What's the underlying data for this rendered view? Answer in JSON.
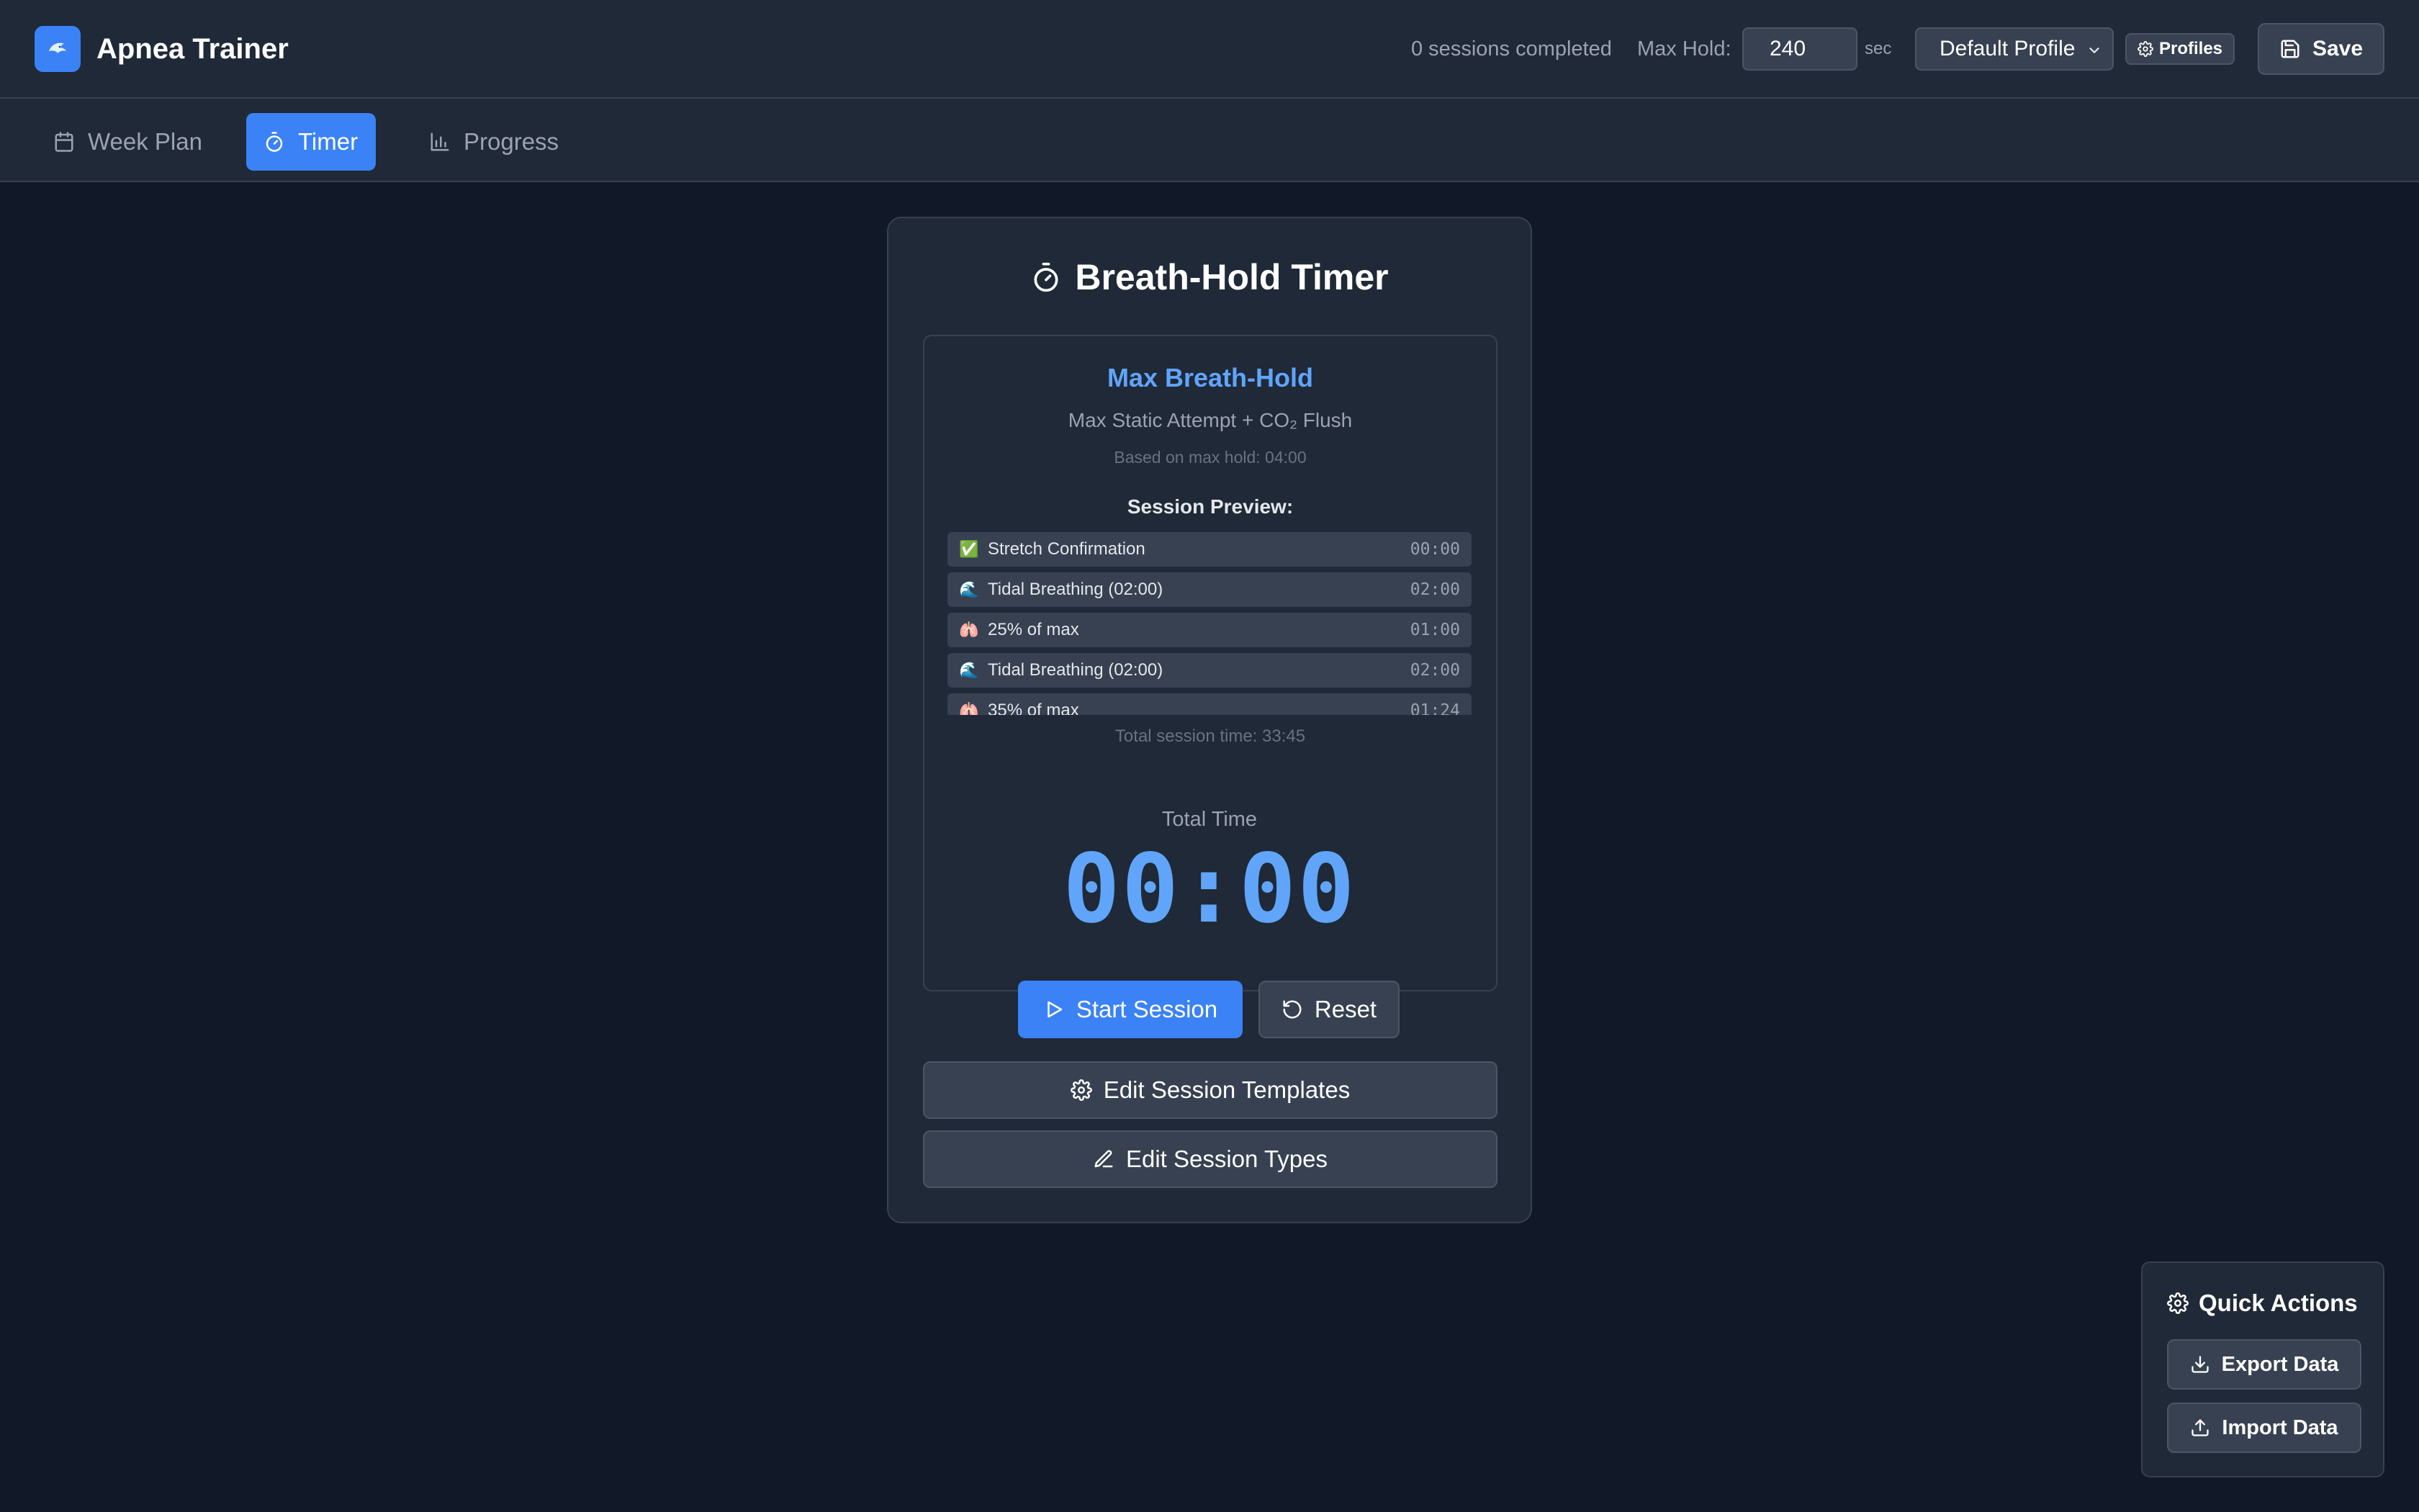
{
  "header": {
    "app_icon": "dolphin-logo",
    "app_title": "Apnea Trainer",
    "sessions_completed": "0 sessions completed",
    "max_hold_label": "Max Hold:",
    "max_hold_value": "240",
    "max_hold_unit": "sec",
    "profile_selected": "Default Profile",
    "profiles_button": "Profiles",
    "save_button": "Save"
  },
  "tabs": [
    {
      "label": "Week Plan",
      "icon": "calendar-icon",
      "active": false
    },
    {
      "label": "Timer",
      "icon": "stopwatch-icon",
      "active": true
    },
    {
      "label": "Progress",
      "icon": "bar-chart-icon",
      "active": false
    }
  ],
  "timer_card": {
    "title": "Breath-Hold Timer",
    "session_name": "Max Breath-Hold",
    "session_subtitle": "Max Static Attempt + CO₂ Flush",
    "based_on": "Based on max hold: 04:00",
    "preview_heading": "Session Preview:",
    "preview": [
      {
        "emoji": "✅",
        "label": "Stretch Confirmation",
        "time": "00:00"
      },
      {
        "emoji": "🌊",
        "label": "Tidal Breathing (02:00)",
        "time": "02:00"
      },
      {
        "emoji": "🫁",
        "label": "25% of max",
        "time": "01:00"
      },
      {
        "emoji": "🌊",
        "label": "Tidal Breathing (02:00)",
        "time": "02:00"
      },
      {
        "emoji": "🫁",
        "label": "35% of max",
        "time": "01:24"
      }
    ],
    "total_session_time": "Total session time: 33:45",
    "timer_label": "Total Time",
    "timer_value": "00:00",
    "start_button": "Start Session",
    "reset_button": "Reset",
    "edit_templates_button": "Edit Session Templates",
    "edit_types_button": "Edit Session Types"
  },
  "quick_actions": {
    "title": "Quick Actions",
    "export_button": "Export Data",
    "import_button": "Import Data"
  },
  "colors": {
    "background": "#111827",
    "panel": "#1f2937",
    "accent": "#3b82f6",
    "accent_text": "#60a5fa"
  }
}
